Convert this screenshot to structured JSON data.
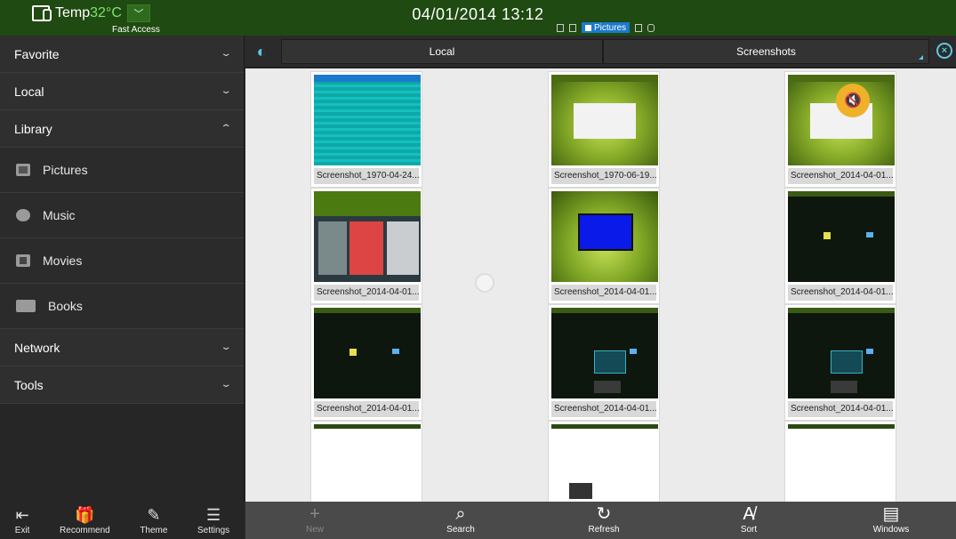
{
  "topbar": {
    "temp_label": "Temp",
    "temp_value": "32°C",
    "fast_access": "Fast Access",
    "datetime": "04/01/2014 13:12",
    "status_chip": "Pictures"
  },
  "sidebar": {
    "sections": [
      {
        "label": "Favorite",
        "state": "collapsed"
      },
      {
        "label": "Local",
        "state": "collapsed"
      },
      {
        "label": "Library",
        "state": "expanded"
      }
    ],
    "library_items": [
      {
        "label": "Pictures",
        "icon": "picture-icon"
      },
      {
        "label": "Music",
        "icon": "music-icon"
      },
      {
        "label": "Movies",
        "icon": "movie-icon"
      },
      {
        "label": "Books",
        "icon": "book-icon"
      }
    ],
    "lower_sections": [
      {
        "label": "Network",
        "state": "collapsed"
      },
      {
        "label": "Tools",
        "state": "collapsed"
      }
    ]
  },
  "bottom_left": {
    "exit": "Exit",
    "recommend": "Recommend",
    "theme": "Theme",
    "settings": "Settings"
  },
  "pathbar": {
    "crumb_local": "Local",
    "crumb_current": "Screenshots"
  },
  "files": [
    {
      "name": "Screenshot_1970-04-24..."
    },
    {
      "name": "Screenshot_1970-06-19..."
    },
    {
      "name": "Screenshot_2014-04-01..."
    },
    {
      "name": "Screenshot_2014-04-01..."
    },
    {
      "name": "Screenshot_2014-04-01..."
    },
    {
      "name": "Screenshot_2014-04-01..."
    },
    {
      "name": "Screenshot_2014-04-01..."
    },
    {
      "name": "Screenshot_2014-04-01..."
    },
    {
      "name": "Screenshot_2014-04-01..."
    }
  ],
  "bottom_right": {
    "new": "New",
    "search": "Search",
    "refresh": "Refresh",
    "sort": "Sort",
    "windows": "Windows"
  },
  "colors": {
    "topbar": "#1f4a12",
    "accent": "#5bc8e8",
    "temp": "#7ee36a",
    "mute_badge": "#f0b12a"
  }
}
